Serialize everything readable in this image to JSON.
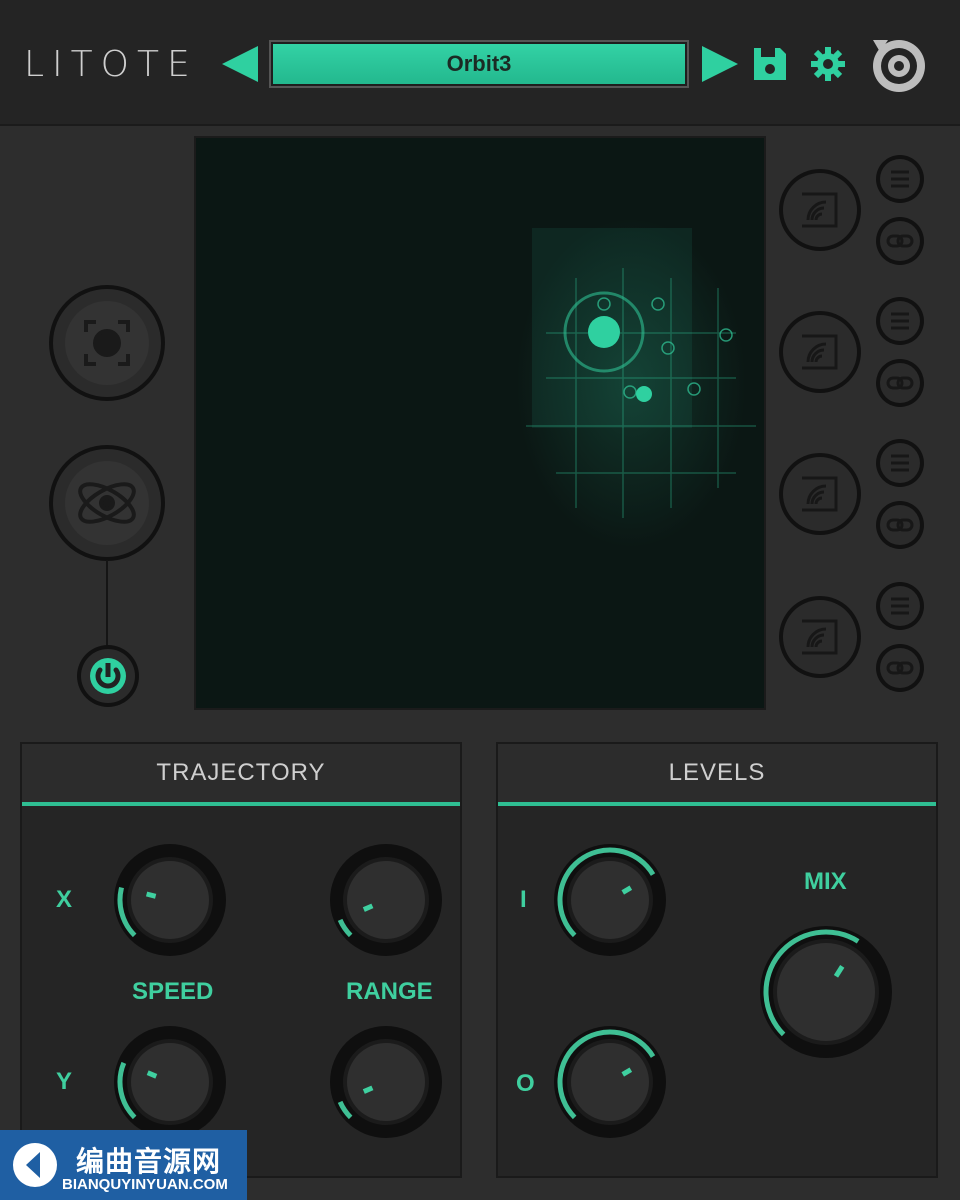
{
  "header": {
    "logo_text": "LITOTE",
    "preset_name": "Orbit3",
    "icons": [
      "prev-arrow-icon",
      "next-arrow-icon",
      "save-icon",
      "gear-icon",
      "brand-disc-icon"
    ]
  },
  "colors": {
    "accent": "#2fbf93",
    "background": "#2d2d2d",
    "pad": "#0b1714"
  },
  "left_column": {
    "icons": [
      "focus-target-icon",
      "atom-icon",
      "power-icon"
    ]
  },
  "right_column": {
    "source_icons": [
      "spatial-source-1-icon",
      "spatial-source-2-icon",
      "spatial-source-3-icon",
      "spatial-source-4-icon"
    ],
    "side_icons": [
      "list-icon",
      "link-icon"
    ]
  },
  "trajectory": {
    "title": "TRAJECTORY",
    "x_label": "X",
    "y_label": "Y",
    "speed_label": "SPEED",
    "range_label": "RANGE",
    "speed_x": 0.22,
    "speed_y": 0.25,
    "range_x": 0.08,
    "range_y": 0.08
  },
  "levels": {
    "title": "LEVELS",
    "i_label": "I",
    "o_label": "O",
    "mix_label": "MIX",
    "input_level": 0.72,
    "output_level": 0.72,
    "mix_level": 0.62
  },
  "watermark": {
    "title": "编曲音源网",
    "subtitle": "BIANQUYINYUAN.COM"
  }
}
